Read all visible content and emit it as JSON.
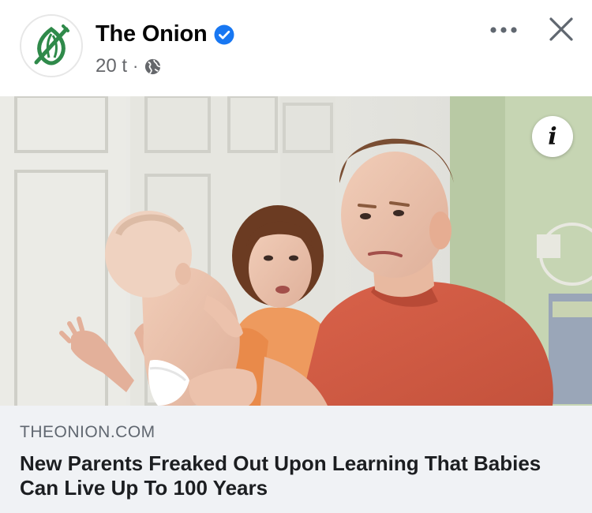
{
  "post": {
    "page_name": "The Onion",
    "verified_icon": "verified-badge-icon",
    "timestamp": "20 t",
    "separator": "·",
    "audience_icon": "globe-icon",
    "more_icon": "more-options-icon",
    "close_icon": "close-icon"
  },
  "media": {
    "info_label": "i"
  },
  "link": {
    "domain": "THEONION.COM",
    "title": "New Parents Freaked Out Upon Learning That Babies Can Live Up To 100 Years"
  },
  "colors": {
    "verified": "#1877f2",
    "footer_bg": "#f0f2f5",
    "logo_green": "#2f8a4a"
  }
}
